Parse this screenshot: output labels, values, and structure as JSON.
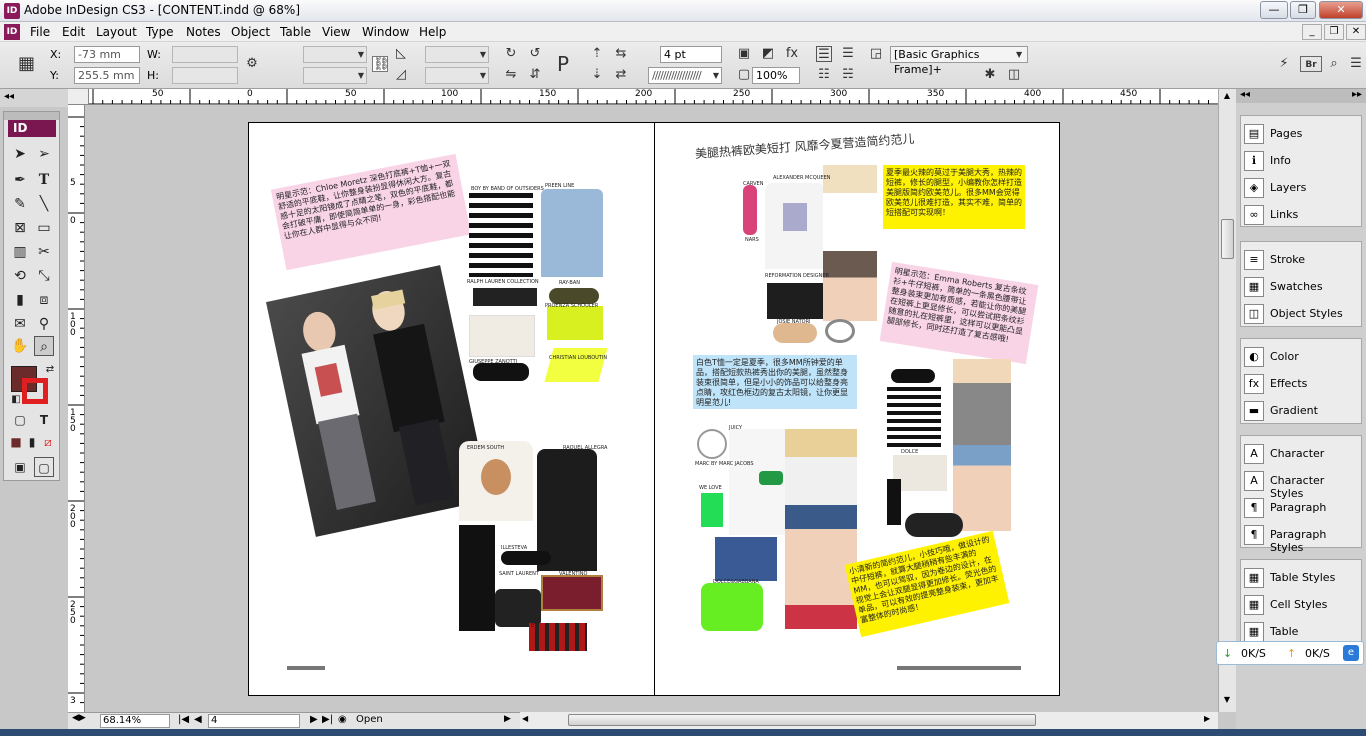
{
  "window": {
    "title": "Adobe InDesign CS3 - [CONTENT.indd @ 68%]",
    "app_badge": "ID",
    "minimize": "—",
    "restore": "❐",
    "close": "✕"
  },
  "menu": {
    "items": [
      "File",
      "Edit",
      "Layout",
      "Type",
      "Notes",
      "Object",
      "Table",
      "View",
      "Window",
      "Help"
    ]
  },
  "control": {
    "x_label": "X:",
    "y_label": "Y:",
    "w_label": "W:",
    "h_label": "H:",
    "x_value": "-73 mm",
    "y_value": "255.5 mm",
    "stroke_weight": "4 pt",
    "zoom_percent": "100%",
    "object_style": "[Basic Graphics Frame]+"
  },
  "rulers": {
    "top_labels": [
      "50",
      "0",
      "50",
      "100",
      "150",
      "200",
      "250",
      "300",
      "350",
      "400",
      "450"
    ],
    "left_labels": [
      "5",
      "0",
      "1 0 0",
      "1 5 0",
      "2 0 0",
      "2 5 0",
      "3"
    ]
  },
  "toolbox": {
    "logo": "ID"
  },
  "spread": {
    "left": {
      "pink_caption": "明星示范：Chloe Moretz 深色打底裤+T恤+一双舒适的平底鞋，让你整身装扮显得休闲大方。复古感十足的太阳镜成了点睛之笔，双色的平底鞋，都会打破平庸，即使简简单单的一身，彩色搭配也能让你在人群中显得与众不同!",
      "prod_captions": [
        "BOY BY BAND OF OUTSIDERS",
        "PREEN LINE",
        "RALPH LAUREN COLLECTION",
        "RAY-BAN",
        "PROENZA SCHOULER",
        "GIUSEPPE ZANOTTI",
        "CHRISTIAN LOUBOUTIN",
        "ERDEM SOUTH",
        "RAQUEL ALLEGRA",
        "ILLESTEVA",
        "SAINT LAURENT",
        "VALENTINO",
        "MARC BY"
      ]
    },
    "right": {
      "headline": "美腿热裤欧美短打 风靡今夏营造简约范儿",
      "yellow_top": "夏季最火辣的莫过于美腿大秀，热辣的短裤，修长的腿型，小编教你怎样打造美腿版简约欧美范儿。很多MM会觉得欧美范儿很难打造，其实不难，简单的短搭配可实现啊！",
      "pink_caption": "明星示范：Emma Roberts 复古条纹衫+牛仔短裤，简单的一条黑色腰带让整身装束更加有质感，若能让你的美腿在短裤上更显修长，可以尝试把条纹衫随意的扎在短裤里，这样可以更能凸显腿部修长，同时还打造了复古感哦!",
      "blue_caption": "白色T恤一定是夏季，很多MM所钟爱的单品，搭配短款热裤秀出你的美腿，虽然整身装束很简单，但是小小的饰品可以给整身亮点睛，攻红色框边的复古太阳镜，让你更显明星范儿!",
      "yellow_bottom": "小清新的简约范儿，小技巧哦，做设计的中仔短裤，就算大腿稍稍有些丰满的MM，也可以驾驭，因为卷边的设计，在视觉上会让双腿显得更加修长。荧光色的单品，可以有效的提亮整身装束，更加丰富整体的时尚感！",
      "prod_captions": [
        "CARVEN",
        "ALEXANDER MCQUEEN",
        "REFORMATION DESIGNER",
        "NARS",
        "JOSIE NATORI",
        "DOLCE",
        "MARC BY MARC JACOBS",
        "WE LOVE",
        "DOLCE&GABBANA",
        "JUICY",
        "CHLOE"
      ]
    }
  },
  "panels": [
    {
      "items": [
        {
          "icon": "pages-icon",
          "glyph": "▤",
          "label": "Pages"
        },
        {
          "icon": "info-icon",
          "glyph": "ℹ",
          "label": "Info"
        },
        {
          "icon": "layers-icon",
          "glyph": "◈",
          "label": "Layers"
        },
        {
          "icon": "links-icon",
          "glyph": "∞",
          "label": "Links"
        }
      ]
    },
    {
      "items": [
        {
          "icon": "stroke-icon",
          "glyph": "≡",
          "label": "Stroke"
        },
        {
          "icon": "swatches-icon",
          "glyph": "▦",
          "label": "Swatches"
        },
        {
          "icon": "object-styles-icon",
          "glyph": "◫",
          "label": "Object Styles"
        }
      ]
    },
    {
      "items": [
        {
          "icon": "color-icon",
          "glyph": "◐",
          "label": "Color"
        },
        {
          "icon": "effects-icon",
          "glyph": "fx",
          "label": "Effects"
        },
        {
          "icon": "gradient-icon",
          "glyph": "▬",
          "label": "Gradient"
        }
      ]
    },
    {
      "items": [
        {
          "icon": "character-icon",
          "glyph": "A",
          "label": "Character"
        },
        {
          "icon": "character-styles-icon",
          "glyph": "A",
          "label": "Character Styles"
        },
        {
          "icon": "paragraph-icon",
          "glyph": "¶",
          "label": "Paragraph"
        },
        {
          "icon": "paragraph-styles-icon",
          "glyph": "¶",
          "label": "Paragraph Styles"
        }
      ]
    },
    {
      "items": [
        {
          "icon": "table-styles-icon",
          "glyph": "▦",
          "label": "Table Styles"
        },
        {
          "icon": "cell-styles-icon",
          "glyph": "▦",
          "label": "Cell Styles"
        },
        {
          "icon": "table-icon",
          "glyph": "▦",
          "label": "Table"
        }
      ]
    }
  ],
  "network": {
    "down": "0K/S",
    "up": "0K/S"
  },
  "status": {
    "zoom": "68.14%",
    "page": "4",
    "state": "Open"
  },
  "colors": {
    "fill": "#6b2b2b",
    "stroke": "#e02020",
    "pink": "#f8d4e6",
    "yellow": "#fff200",
    "blue": "#bfe3f8",
    "logo": "#7a1750"
  }
}
